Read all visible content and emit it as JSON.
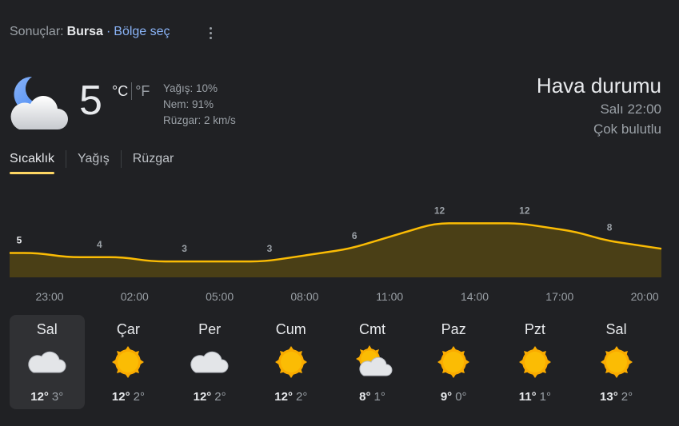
{
  "header": {
    "results_label": "Sonuçlar:",
    "location": "Bursa",
    "separator": "·",
    "region_link": "Bölge seç",
    "more_icon": "more-vert-icon"
  },
  "current": {
    "icon": "night-cloudy-icon",
    "temp": "5",
    "unit_c": "°C",
    "unit_f": "°F",
    "precip": "Yağış: 10%",
    "humidity": "Nem: 91%",
    "wind": "Rüzgar: 2 km/s"
  },
  "title": {
    "heading": "Hava durumu",
    "time": "Salı 22:00",
    "condition": "Çok bulutlu"
  },
  "tabs": [
    {
      "label": "Sıcaklık",
      "active": true
    },
    {
      "label": "Yağış",
      "active": false
    },
    {
      "label": "Rüzgar",
      "active": false
    }
  ],
  "chart_data": {
    "type": "area",
    "x": [
      "23:00",
      "00:00",
      "01:00",
      "02:00",
      "03:00",
      "04:00",
      "05:00",
      "06:00",
      "07:00",
      "08:00",
      "09:00",
      "10:00",
      "11:00",
      "12:00",
      "13:00",
      "14:00",
      "15:00",
      "16:00",
      "17:00",
      "18:00",
      "19:00",
      "20:00",
      "21:00",
      "22:00"
    ],
    "values": [
      5,
      5,
      4,
      4,
      4,
      3,
      3,
      3,
      3,
      3,
      4,
      5,
      6,
      8,
      10,
      12,
      12,
      12,
      12,
      11,
      10,
      8,
      7,
      6
    ],
    "labels_every": 3,
    "tick_labels": [
      "23:00",
      "02:00",
      "05:00",
      "08:00",
      "11:00",
      "14:00",
      "17:00",
      "20:00"
    ],
    "line_color": "#fbbc04",
    "fill_color": "#4a3f16"
  },
  "forecast": [
    {
      "day": "Sal",
      "icon": "cloudy-icon",
      "high": "12°",
      "low": "3°",
      "selected": true
    },
    {
      "day": "Çar",
      "icon": "sunny-icon",
      "high": "12°",
      "low": "2°",
      "selected": false
    },
    {
      "day": "Per",
      "icon": "cloudy-icon",
      "high": "12°",
      "low": "2°",
      "selected": false
    },
    {
      "day": "Cum",
      "icon": "sunny-icon",
      "high": "12°",
      "low": "2°",
      "selected": false
    },
    {
      "day": "Cmt",
      "icon": "partly-cloudy-icon",
      "high": "8°",
      "low": "1°",
      "selected": false
    },
    {
      "day": "Paz",
      "icon": "sunny-icon",
      "high": "9°",
      "low": "0°",
      "selected": false
    },
    {
      "day": "Pzt",
      "icon": "sunny-icon",
      "high": "11°",
      "low": "1°",
      "selected": false
    },
    {
      "day": "Sal",
      "icon": "sunny-icon",
      "high": "13°",
      "low": "2°",
      "selected": false
    }
  ]
}
